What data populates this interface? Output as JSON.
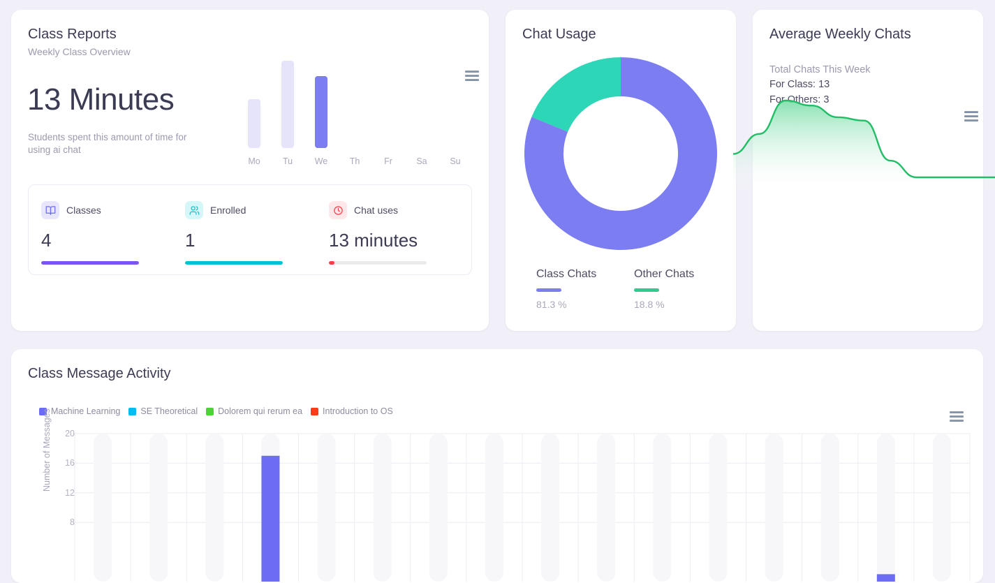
{
  "class_reports": {
    "title": "Class Reports",
    "subtitle": "Weekly Class Overview",
    "big_value": "13 Minutes",
    "description": "Students spent this amount of time for using ai chat",
    "menu_icon": "hamburger-menu-icon",
    "stats": [
      {
        "label": "Classes",
        "value": "4",
        "icon": "book-icon",
        "color": "#7b7df0",
        "icon_bg": "#e8e6fd",
        "progress": 100
      },
      {
        "label": "Enrolled",
        "value": "1",
        "icon": "users-icon",
        "color": "#00c2d4",
        "icon_bg": "#d6f7f8",
        "progress": 100
      },
      {
        "label": "Chat uses",
        "value": "13 minutes",
        "icon": "clock-icon",
        "color": "#fb3d4a",
        "icon_bg": "#fde7e9",
        "progress": 6
      }
    ],
    "chart_data": {
      "type": "bar",
      "title": "Weekly Class Overview",
      "categories": [
        "Mo",
        "Tu",
        "We",
        "Th",
        "Fr",
        "Sa",
        "Su"
      ],
      "values": [
        6.5,
        11.5,
        9.5,
        0,
        0,
        0,
        0
      ],
      "active_index": 2,
      "bar_color": "#e6e4fb",
      "active_bar_color": "#7b7df0",
      "ylim": [
        0,
        12
      ],
      "xlabel": "",
      "ylabel": "",
      "grid": false
    }
  },
  "chat_usage": {
    "title": "Chat Usage",
    "chart_data": {
      "type": "pie",
      "title": "Chat Usage",
      "donut": true,
      "labels": [
        "Class Chats",
        "Other Chats"
      ],
      "values": [
        81.3,
        18.8
      ],
      "value_labels": [
        "81.3 %",
        "18.8 %"
      ],
      "colors": [
        "#7b7df0",
        "#2ed6b8"
      ],
      "legend_position": "bottom"
    }
  },
  "weekly": {
    "title": "Average Weekly Chats",
    "subtitle": "Total Chats This Week",
    "for_class": "For Class: 13",
    "for_others": "For Others: 3",
    "menu_icon": "hamburger-menu-icon",
    "chart_data": {
      "type": "area",
      "title": "Average Weekly Chats",
      "x": [
        0,
        1,
        2,
        3,
        4,
        5,
        6,
        7,
        8,
        9,
        10
      ],
      "values": [
        1.4,
        2.6,
        4.6,
        4.3,
        3.6,
        3.4,
        1.0,
        0,
        0,
        0,
        0
      ],
      "line_color": "#22bd66",
      "fill_color": "#8fe3b5",
      "grid": false,
      "xlabel": "",
      "ylabel": ""
    }
  },
  "activity": {
    "title": "Class Message Activity",
    "menu_icon": "hamburger-menu-icon",
    "chart_data": {
      "type": "bar",
      "title": "Class Message Activity",
      "ylabel": "Number of Messages",
      "xlabel": "",
      "yticks": [
        "20",
        "16",
        "12",
        "8"
      ],
      "ytick_values": [
        20,
        16,
        12,
        8
      ],
      "ylim": [
        0,
        20
      ],
      "grid": true,
      "legend_position": "top-left",
      "series": [
        {
          "name": "Machine Learning",
          "color": "#6c6cf5",
          "values": [
            0,
            0,
            0,
            17,
            0,
            0,
            0,
            0,
            0,
            0,
            0,
            0,
            0,
            0,
            1,
            0
          ]
        },
        {
          "name": "SE Theoretical",
          "color": "#06bdf0",
          "values": [
            0,
            0,
            0,
            0,
            0,
            0,
            0,
            0,
            0,
            0,
            0,
            0,
            0,
            0,
            0,
            0
          ]
        },
        {
          "name": "Dolorem qui rerum ea",
          "color": "#4fd13a",
          "values": [
            0,
            0,
            0,
            0,
            0,
            0,
            0,
            0,
            0,
            0,
            0,
            0,
            0,
            0,
            0,
            0
          ]
        },
        {
          "name": "Introduction to OS",
          "color": "#fb3c18",
          "values": [
            0,
            0,
            0,
            0,
            0,
            0,
            0,
            0,
            0,
            0,
            0,
            0,
            0,
            0,
            0,
            0
          ]
        }
      ]
    }
  }
}
